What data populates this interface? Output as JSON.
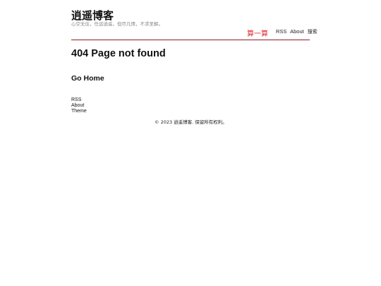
{
  "header": {
    "site_title": "逍遥博客",
    "site_description": "心空无住，任运逍遥，但尽凡情，不求圣解。",
    "calc_link": "算一算",
    "nav": {
      "rss": "RSS",
      "about": "About",
      "search": "搜索"
    }
  },
  "main": {
    "error_title": "404 Page not found",
    "home_link": "Go Home"
  },
  "footer": {
    "links": [
      "RSS",
      "About",
      "Theme"
    ],
    "copyright": "© 2023 逍遥博客. 保留所有权利。"
  },
  "colors": {
    "accent_red": "#e0262b",
    "rule": "#8a1f24",
    "muted_text": "#888888"
  }
}
